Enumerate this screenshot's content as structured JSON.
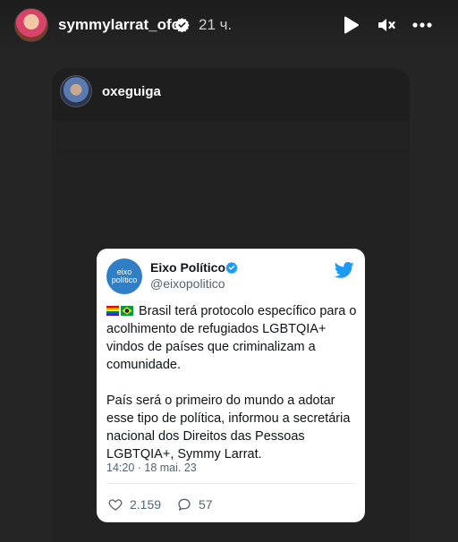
{
  "story": {
    "username": "symmylarrat_ofc",
    "time": "21 ч.",
    "controls": [
      "play-icon",
      "mute-icon",
      "more-icon"
    ]
  },
  "shared_post": {
    "username": "oxeguiga"
  },
  "tweet": {
    "avatar_text": "eixo político",
    "name": "Eixo Político",
    "handle": "@eixopolitico",
    "flags": [
      "rainbow-flag",
      "brazil-flag"
    ],
    "paragraph1": "Brasil terá protocolo específico para o acolhimento de refugiados LGBTQIA+ vindos de países que criminalizam a comunidade.",
    "paragraph2": "País será o primeiro do mundo a adotar esse tipo de política, informou a secretária nacional dos Direitos das Pessoas LGBTQIA+, Symmy Larrat.",
    "timestamp": "14:20 · 18 mai. 23",
    "likes": "2.159",
    "replies": "57"
  },
  "colors": {
    "background": "#252525",
    "twitter_blue": "#1d9bf0",
    "avatar_blue": "#2f7ec6"
  }
}
